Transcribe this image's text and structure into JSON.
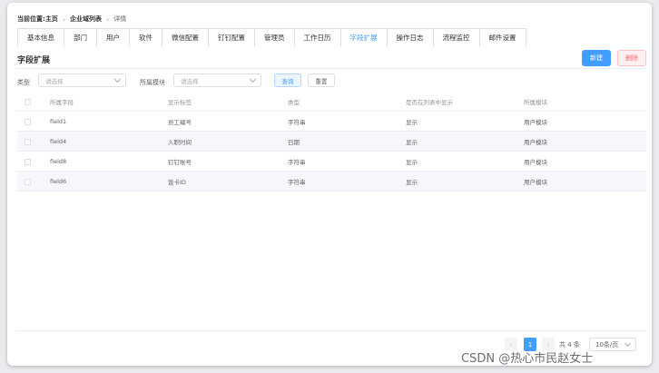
{
  "breadcrumb": {
    "prefix": "当前位置:",
    "items": [
      "主页",
      "企业域列表",
      "详情"
    ]
  },
  "tabs": [
    {
      "label": "基本信息",
      "active": false
    },
    {
      "label": "部门",
      "active": false
    },
    {
      "label": "用户",
      "active": false
    },
    {
      "label": "软件",
      "active": false
    },
    {
      "label": "微信配置",
      "active": false
    },
    {
      "label": "钉钉配置",
      "active": false
    },
    {
      "label": "管理员",
      "active": false
    },
    {
      "label": "工作日历",
      "active": false
    },
    {
      "label": "字段扩展",
      "active": true
    },
    {
      "label": "操作日志",
      "active": false
    },
    {
      "label": "流程监控",
      "active": false
    },
    {
      "label": "邮件设置",
      "active": false
    }
  ],
  "section": {
    "title": "字段扩展"
  },
  "actions": {
    "new_label": "新建",
    "delete_label": "删除"
  },
  "filters": {
    "type_label": "类型",
    "type_placeholder": "请选择",
    "module_label": "所属模块",
    "module_placeholder": "请选择",
    "query_label": "查询",
    "reset_label": "重置"
  },
  "table": {
    "columns": [
      "所属字段",
      "显示标签",
      "类型",
      "是否在列表中显示",
      "所属模块"
    ],
    "rows": [
      [
        "field1",
        "员工编号",
        "字符串",
        "显示",
        "用户模块"
      ],
      [
        "field4",
        "入职时间",
        "日期",
        "显示",
        "用户模块"
      ],
      [
        "field8",
        "钉钉账号",
        "字符串",
        "显示",
        "用户模块"
      ],
      [
        "field6",
        "饭卡ID",
        "字符串",
        "显示",
        "用户模块"
      ]
    ]
  },
  "pagination": {
    "prev": "‹",
    "current": "1",
    "next": "›",
    "total": "共 4 条",
    "page_size": "10条/页"
  },
  "watermark": "CSDN @热心市民赵女士",
  "colors": {
    "accent": "#409eff",
    "danger": "#f56c6c",
    "stripe": "#f5f7fa"
  }
}
